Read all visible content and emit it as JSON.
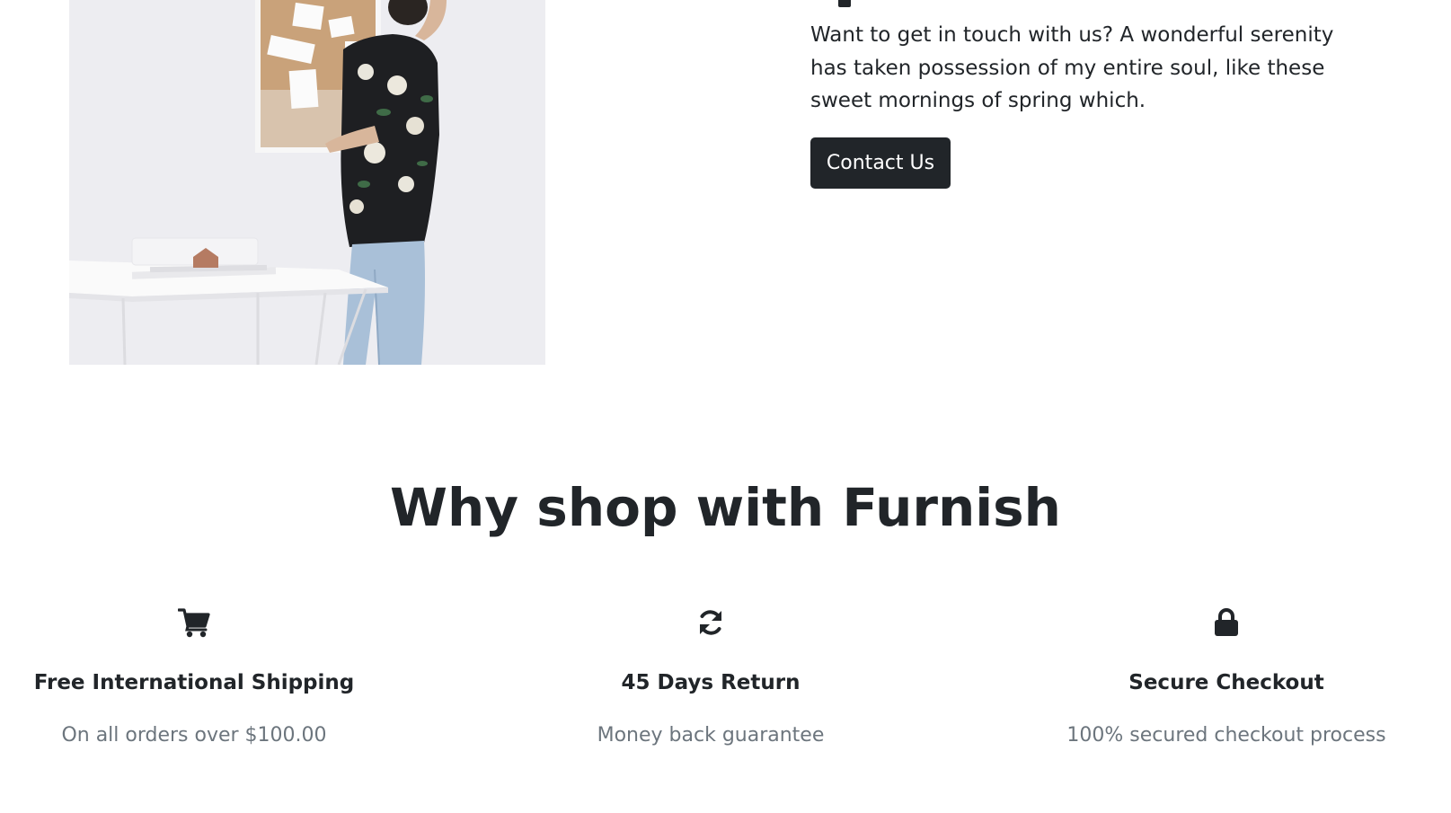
{
  "contact": {
    "text": "Want to get in touch with us? A wonderful serenity has taken possession of my entire soul, like these sweet mornings of spring which.",
    "button_label": "Contact Us"
  },
  "why_shop": {
    "title": "Why shop with Furnish",
    "features": [
      {
        "icon": "shopping-cart-icon",
        "title": "Free International Shipping",
        "text": "On all orders over $100.00"
      },
      {
        "icon": "refresh-icon",
        "title": "45 Days Return",
        "text": "Money back guarantee"
      },
      {
        "icon": "lock-icon",
        "title": "Secure Checkout",
        "text": "100% secured checkout process"
      }
    ]
  },
  "colors": {
    "text_dark": "#212529",
    "text_muted": "#6c757d",
    "button_bg": "#212529",
    "background": "#ffffff"
  }
}
